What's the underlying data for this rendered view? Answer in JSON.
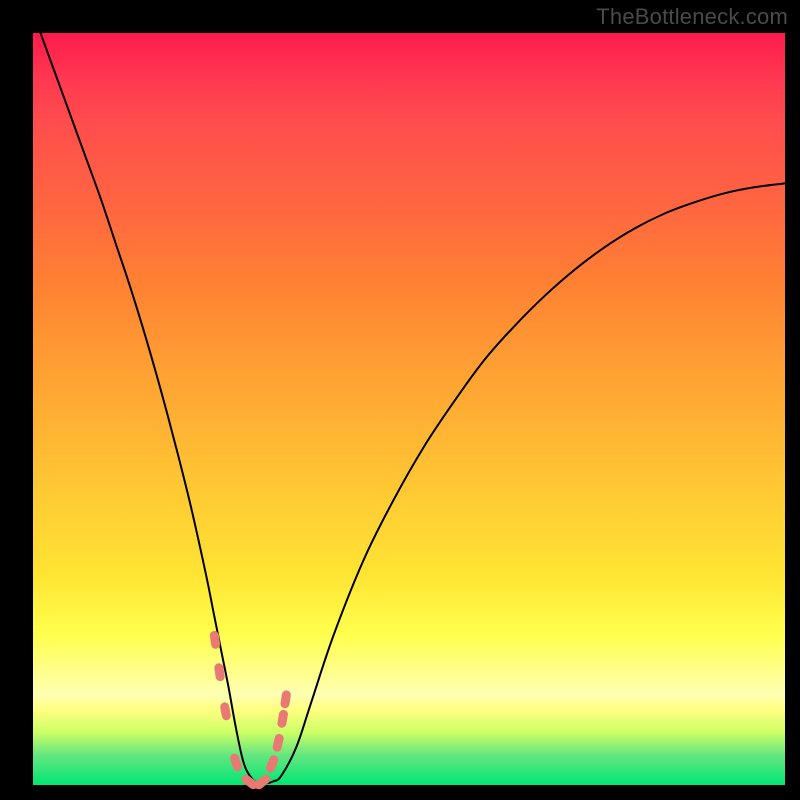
{
  "watermark": "TheBottleneck.com",
  "colors": {
    "background": "#000000",
    "curve": "#000000",
    "marker": "#e87a73",
    "gradient_top": "#ff1a4d",
    "gradient_bottom": "#00e673"
  },
  "chart_data": {
    "type": "line",
    "title": "",
    "xlabel": "",
    "ylabel": "",
    "xlim": [
      0,
      100
    ],
    "ylim": [
      0,
      100
    ],
    "x": [
      1,
      3,
      5,
      7,
      9,
      11,
      13,
      15,
      17,
      19,
      21,
      23,
      24,
      25,
      26,
      27,
      28,
      29,
      30,
      31,
      32,
      33,
      35,
      37,
      40,
      44,
      48,
      52,
      56,
      60,
      64,
      68,
      72,
      76,
      80,
      84,
      88,
      92,
      96,
      100
    ],
    "values": [
      100,
      94.5,
      89,
      83.5,
      78,
      72,
      66,
      59.5,
      52.5,
      45,
      37,
      28,
      23,
      18,
      13,
      7.5,
      3,
      1,
      0.2,
      0.2,
      0.5,
      1.2,
      5,
      11,
      20,
      30,
      38,
      45,
      51,
      56.5,
      61,
      65,
      68.5,
      71.5,
      74,
      76,
      77.5,
      78.7,
      79.5,
      80
    ],
    "markers": {
      "x": [
        24.2,
        24.8,
        25.6,
        27.0,
        28.8,
        30.5,
        31.8,
        32.6,
        33.2,
        33.6
      ],
      "y": [
        19.3,
        15.0,
        9.8,
        3.0,
        0.4,
        0.4,
        2.8,
        5.6,
        8.8,
        11.4
      ]
    }
  }
}
